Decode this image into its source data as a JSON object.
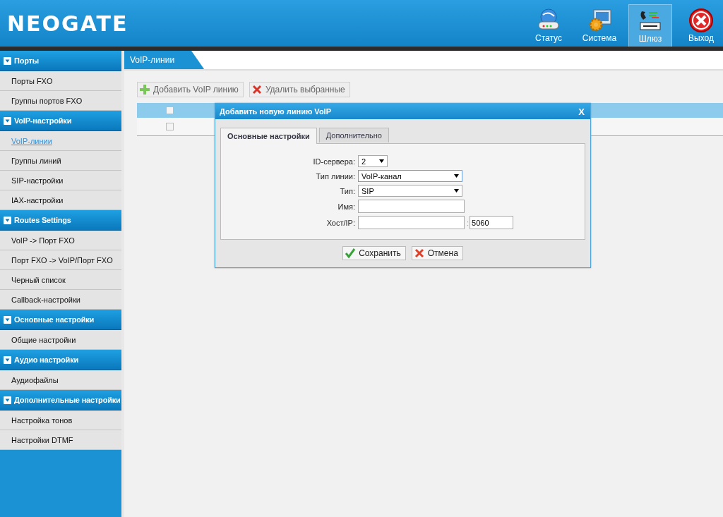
{
  "header": {
    "logo": "NEOGATE",
    "nav": [
      {
        "kind": "status",
        "label": "Статус",
        "selected": false
      },
      {
        "kind": "system",
        "label": "Система",
        "selected": false
      },
      {
        "kind": "gateway",
        "label": "Шлюз",
        "selected": true
      },
      {
        "kind": "exit",
        "label": "Выход",
        "selected": false
      }
    ]
  },
  "sidebar": {
    "groups": [
      {
        "title": "Порты",
        "items": [
          {
            "label": "Порты FXO",
            "selected": false
          },
          {
            "label": "Группы портов FXO",
            "selected": false
          }
        ]
      },
      {
        "title": "VoIP-настройки",
        "items": [
          {
            "label": "VoIP-линии",
            "selected": true
          },
          {
            "label": "Группы линий",
            "selected": false
          },
          {
            "label": "SIP-настройки",
            "selected": false
          },
          {
            "label": "IAX-настройки",
            "selected": false
          }
        ]
      },
      {
        "title": "Routes Settings",
        "items": [
          {
            "label": "VoIP -> Порт FXO",
            "selected": false
          },
          {
            "label": "Порт FXO -> VoIP/Порт FXO",
            "selected": false
          },
          {
            "label": "Черный список",
            "selected": false
          },
          {
            "label": "Callback-настройки",
            "selected": false
          }
        ]
      },
      {
        "title": "Основные настройки",
        "items": [
          {
            "label": "Общие настройки",
            "selected": false
          }
        ]
      },
      {
        "title": "Аудио настройки",
        "items": [
          {
            "label": "Аудиофайлы",
            "selected": false
          }
        ]
      },
      {
        "title": "Дополнительные настройки",
        "items": [
          {
            "label": "Настройка тонов",
            "selected": false
          },
          {
            "label": "Настройки DTMF",
            "selected": false
          }
        ]
      }
    ]
  },
  "page_tab": "VoIP-линии",
  "toolbar": [
    {
      "kind": "add",
      "label": "Добавить VoIP линию"
    },
    {
      "kind": "delete",
      "label": "Удалить выбранные"
    }
  ],
  "table": {
    "header_checked": false,
    "rows": [
      {
        "checked": false
      }
    ]
  },
  "dialog": {
    "title": "Добавить новую линию VoIP",
    "close": "X",
    "tabs": [
      {
        "label": "Основные настройки",
        "selected": true
      },
      {
        "label": "Дополнительно",
        "selected": false
      }
    ],
    "fields": [
      {
        "kind": "short-select",
        "label": "ID-сервера:",
        "value": "2"
      },
      {
        "kind": "select",
        "label": "Тип линии:",
        "value": "VoIP-канал",
        "focused": true
      },
      {
        "kind": "select",
        "label": "Тип:",
        "value": "SIP",
        "focused": false
      },
      {
        "kind": "input",
        "label": "Имя:"
      },
      {
        "kind": "host",
        "label": "Хост/IP:",
        "port_separator": ":",
        "port": "5060"
      }
    ],
    "buttons": [
      {
        "kind": "save",
        "label": "Сохранить"
      },
      {
        "kind": "cancel",
        "label": "Отмена"
      }
    ]
  }
}
